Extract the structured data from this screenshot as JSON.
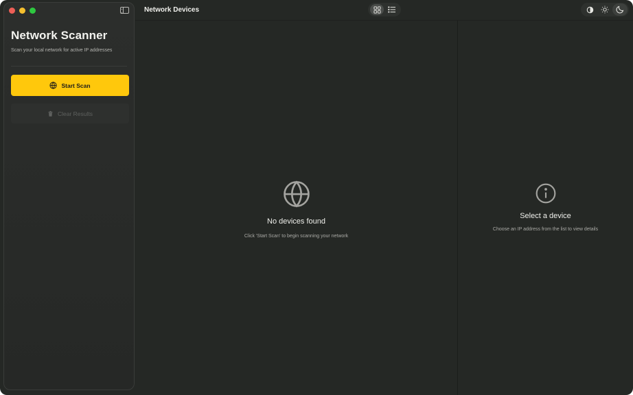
{
  "sidebar": {
    "title": "Network Scanner",
    "subtitle": "Scan your local network for active IP addresses",
    "start_scan_label": "Start Scan",
    "clear_results_label": "Clear Results"
  },
  "header": {
    "title": "Network Devices",
    "view_modes": [
      "grid-icon",
      "list-icon"
    ],
    "theme_modes": [
      "contrast-icon",
      "sun-icon",
      "moon-icon"
    ],
    "active_theme": "moon-icon"
  },
  "main": {
    "empty_title": "No devices found",
    "empty_subtitle": "Click 'Start Scan' to begin scanning your network"
  },
  "details": {
    "empty_title": "Select a device",
    "empty_subtitle": "Choose an IP address from the list to view details"
  },
  "colors": {
    "accent": "#ffc80c",
    "background": "#252825",
    "sidebar": "#2c2e2c"
  }
}
